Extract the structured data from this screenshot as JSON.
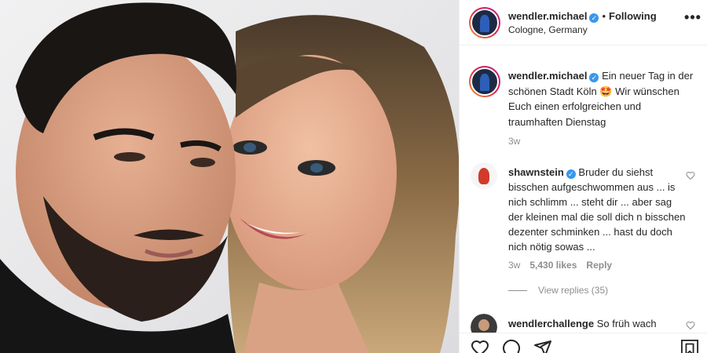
{
  "post": {
    "author": {
      "username": "wendler.michael",
      "verified_icon": "verified-badge-icon",
      "follow_separator": "•",
      "follow_status": "Following",
      "location": "Cologne, Germany"
    },
    "more_label": "•••",
    "caption": {
      "username": "wendler.michael",
      "text": "Ein neuer Tag in der schönen Stadt Köln 🤩 Wir wünschen Euch einen erfolgreichen und traumhaften Dienstag",
      "time": "3w"
    },
    "comments": [
      {
        "username": "shawnstein",
        "verified": true,
        "text": "Bruder du siehst bisschen aufgeschwommen aus ... is nich schlimm ... steht dir ... aber sag der kleinen mal die soll dich n bisschen dezenter schminken ... hast du doch nich nötig sowas ...",
        "time": "3w",
        "likes": "5,430 likes",
        "reply_label": "Reply",
        "view_replies": "View replies (35)"
      },
      {
        "username": "wendlerchallenge",
        "text": "So früh wach"
      }
    ],
    "action_icons": [
      "heart-icon",
      "comment-icon",
      "share-icon",
      "bookmark-icon"
    ]
  },
  "colors": {
    "verified": "#3897f0",
    "muted": "#8e8e8e",
    "text": "#262626",
    "border": "#efefef"
  }
}
